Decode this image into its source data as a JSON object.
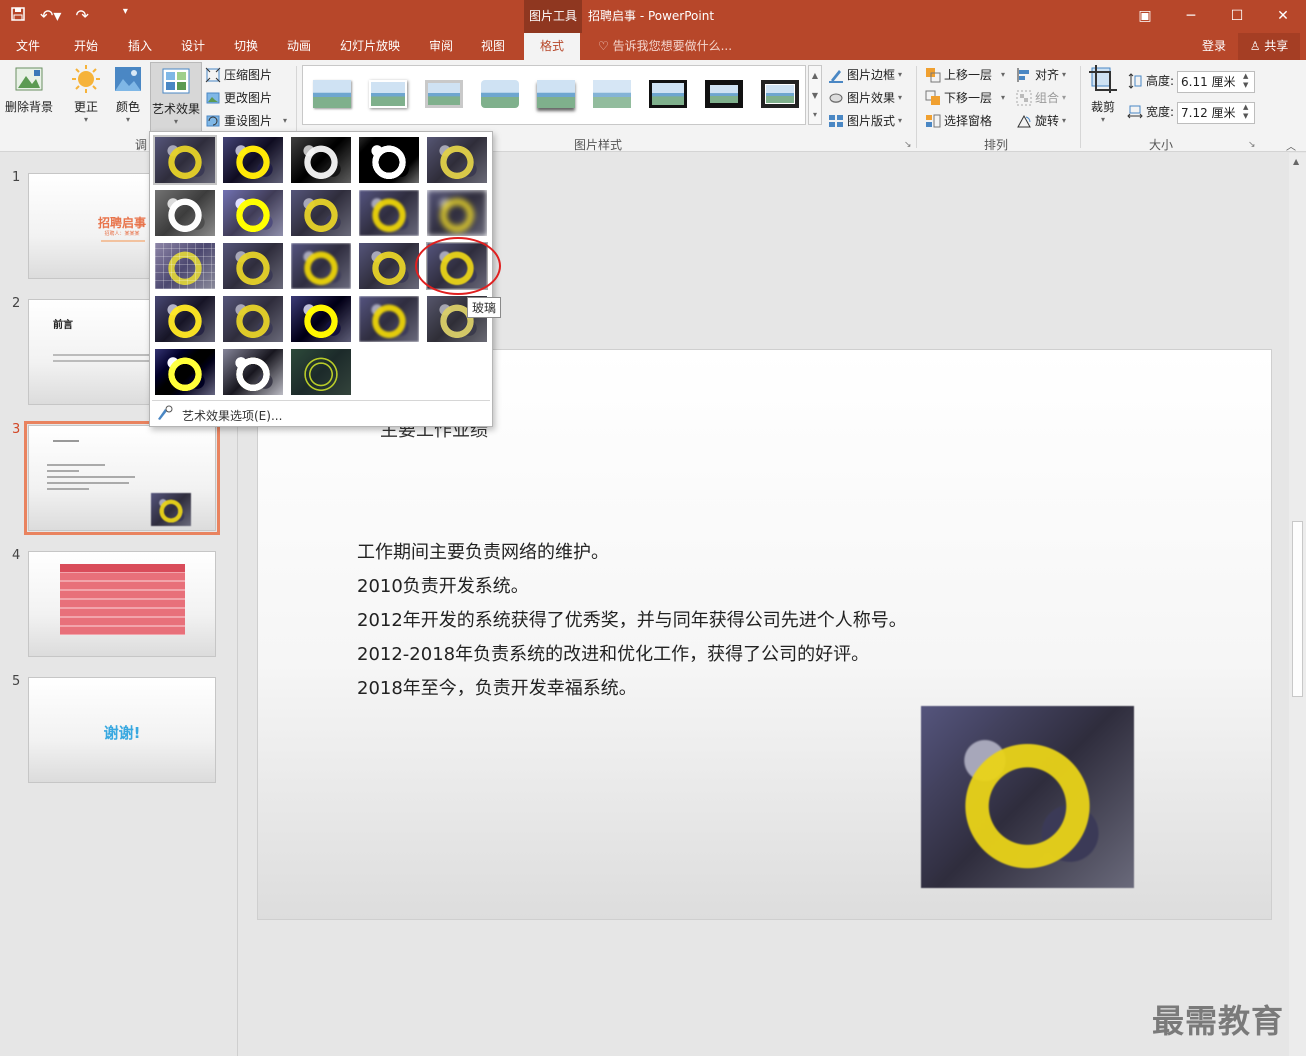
{
  "titlebar": {
    "context_tab": "图片工具",
    "doc_title": "招聘启事 - PowerPoint",
    "qat_icons": [
      "save-icon",
      "undo-icon",
      "redo-icon",
      "customize-qat-icon"
    ],
    "window_icons": [
      "ribbon-display-icon",
      "minimize-icon",
      "maximize-icon",
      "close-icon"
    ]
  },
  "tabs": [
    {
      "label": "文件"
    },
    {
      "label": "开始"
    },
    {
      "label": "插入"
    },
    {
      "label": "设计"
    },
    {
      "label": "切换"
    },
    {
      "label": "动画"
    },
    {
      "label": "幻灯片放映"
    },
    {
      "label": "审阅"
    },
    {
      "label": "视图"
    },
    {
      "label": "格式"
    }
  ],
  "tellme": "告诉我您想要做什么...",
  "account": {
    "login": "登录",
    "share": "共享"
  },
  "ribbon": {
    "adjust": {
      "remove_bg": "删除背景",
      "corrections": "更正",
      "color": "颜色",
      "artistic": "艺术效果",
      "compress": "压缩图片",
      "change": "更改图片",
      "reset": "重设图片",
      "group_label": "调"
    },
    "styles": {
      "border": "图片边框",
      "effects": "图片效果",
      "layout": "图片版式",
      "group_label": "图片样式"
    },
    "arrange": {
      "bring_forward": "上移一层",
      "send_backward": "下移一层",
      "selection_pane": "选择窗格",
      "align": "对齐",
      "group": "组合",
      "rotate": "旋转",
      "group_label": "排列"
    },
    "size": {
      "crop": "裁剪",
      "height_label": "高度:",
      "height_value": "6.11 厘米",
      "width_label": "宽度:",
      "width_value": "7.12 厘米",
      "group_label": "大小"
    }
  },
  "thumbnails": {
    "numbers": [
      "1",
      "2",
      "3",
      "4",
      "5"
    ],
    "slide1": {
      "title": "招聘启事",
      "sub": "招聘人：某某某"
    },
    "slide2": {
      "title": "前言"
    },
    "slide5": {
      "title": "谢谢!"
    }
  },
  "slide": {
    "heading": "主要工作业绩",
    "lines": [
      "工作期间主要负责网络的维护。",
      "2010负责开发系统。",
      "2012年开发的系统获得了优秀奖，并与同年获得公司先进个人称号。",
      "2012-2018年负责系统的改进和优化工作，获得了公司的好评。",
      "2018年至今，负责开发幸福系统。"
    ]
  },
  "dropdown": {
    "options_label": "艺术效果选项(E)...",
    "tooltip": "玻璃",
    "selected_index": 0,
    "hovered_index": 14
  },
  "watermark": "最需教育",
  "colors": {
    "accent": "#b7472a",
    "highlight": "#e02020",
    "active_thumb": "#e9835f"
  }
}
